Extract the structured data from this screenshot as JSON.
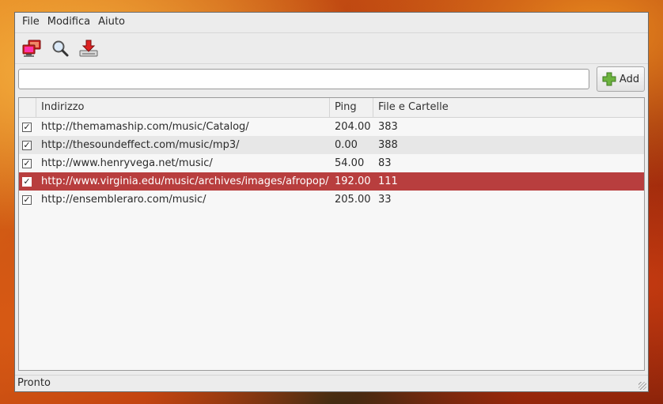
{
  "menu": {
    "items": [
      "File",
      "Modifica",
      "Aiuto"
    ]
  },
  "toolbar": {
    "buttons": [
      "network-icon",
      "search-icon",
      "download-icon"
    ]
  },
  "url_input": {
    "value": "",
    "placeholder": ""
  },
  "add_button": {
    "label": "Add"
  },
  "table": {
    "columns": [
      "Indirizzo",
      "Ping",
      "File e Cartelle"
    ],
    "rows": [
      {
        "url": "http://themamaship.com/music/Catalog/",
        "ping": "204.00",
        "files": "383",
        "checked": "✓"
      },
      {
        "url": "http://thesoundeffect.com/music/mp3/",
        "ping": "0.00",
        "files": "388",
        "checked": "✓"
      },
      {
        "url": "http://www.henryvega.net/music/",
        "ping": "54.00",
        "files": "83",
        "checked": "✓"
      },
      {
        "url": "http://www.virginia.edu/music/archives/images/afropop/",
        "ping": "192.00",
        "files": "111",
        "checked": "✓"
      },
      {
        "url": "http://ensembleraro.com/music/",
        "ping": "205.00",
        "files": "33",
        "checked": "✓"
      }
    ],
    "selected_row": 3
  },
  "status": {
    "text": "Pronto"
  },
  "colors": {
    "selection": "#b83e3e",
    "window": "#ececec"
  }
}
